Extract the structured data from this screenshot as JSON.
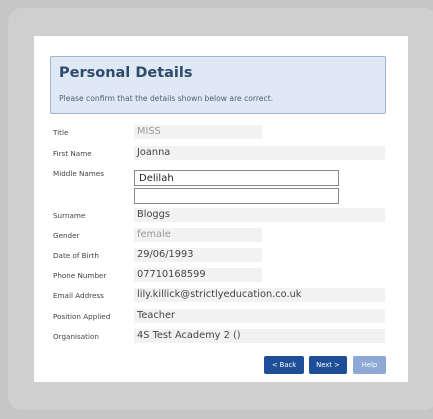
{
  "header": {
    "title": "Personal Details",
    "subtitle": "Please confirm that the details shown below are correct."
  },
  "fields": {
    "title": {
      "label": "Title",
      "value": "MISS"
    },
    "first_name": {
      "label": "First Name",
      "value": "Joanna"
    },
    "middle_names": {
      "label": "Middle Names",
      "value": "Delilah",
      "value2": ""
    },
    "surname": {
      "label": "Surname",
      "value": "Bloggs"
    },
    "gender": {
      "label": "Gender",
      "value": "female"
    },
    "dob": {
      "label": "Date of Birth",
      "value": "29/06/1993"
    },
    "phone": {
      "label": "Phone Number",
      "value": "07710168599"
    },
    "email": {
      "label": "Email Address",
      "value": "lily.killick@strictlyeducation.co.uk"
    },
    "position": {
      "label": "Position Applied",
      "value": "Teacher"
    },
    "organisation": {
      "label": "Organisation",
      "value": "4S Test Academy 2 ()"
    }
  },
  "buttons": {
    "back": "< Back",
    "next": "Next >",
    "help": "Help"
  },
  "colors": {
    "button_primary": "#1f4e99",
    "button_disabled": "#8ea8d6",
    "header_bg": "#dfe9f5"
  }
}
